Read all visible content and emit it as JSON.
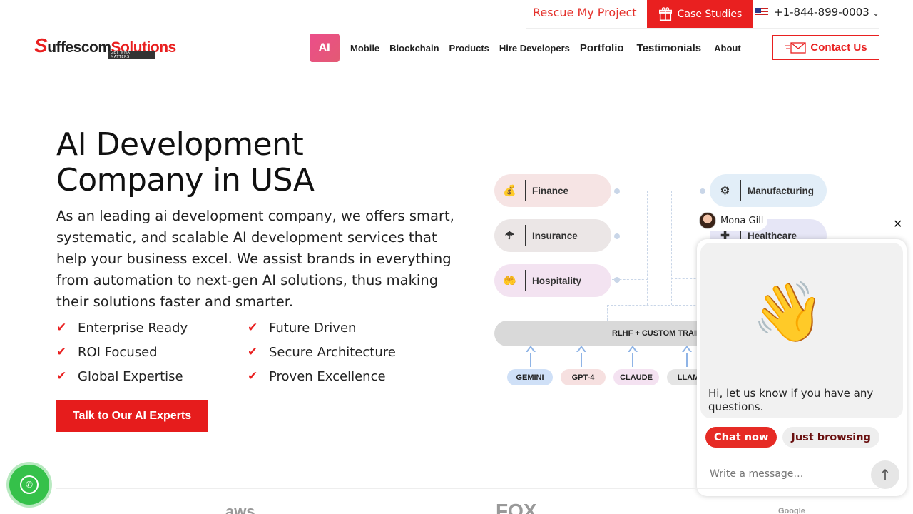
{
  "topbar": {
    "rescue": "Rescue My Project",
    "case_studies": "Case Studies",
    "phone": "+1-844-899-0003"
  },
  "logo": {
    "s": "S",
    "uffescom": "uffescom",
    "solutions": "Solutions",
    "tagline": "GET WHAT MATTERS"
  },
  "nav": {
    "ai": "AI",
    "items": [
      "Mobile",
      "Blockchain",
      "Products",
      "Hire Developers",
      "Portfolio",
      "Testimonials",
      "About"
    ],
    "contact": "Contact Us"
  },
  "hero": {
    "title_line1": "AI Development",
    "title_line2": "Company in USA",
    "description": "As an leading ai development company, we offers smart, systematic, and scalable AI development services that help your business excel. We assist brands in everything from automation to next-gen AI solutions, thus making their solutions faster and smarter.",
    "features": [
      "Enterprise Ready",
      "Future Driven",
      "ROI Focused",
      "Secure Architecture",
      "Global Expertise",
      "Proven Excellence"
    ],
    "cta": "Talk to Our AI Experts"
  },
  "diagram": {
    "left": [
      {
        "label": "Finance",
        "icon": "finance-icon",
        "color": "#f6e4e4"
      },
      {
        "label": "Insurance",
        "icon": "insurance-icon",
        "color": "#ebe6e6"
      },
      {
        "label": "Hospitality",
        "icon": "hospitality-icon",
        "color": "#f3e3f1"
      }
    ],
    "right": [
      {
        "label": "Manufacturing",
        "icon": "manufacturing-icon",
        "color": "#e2eef8"
      },
      {
        "label": "Healthcare",
        "icon": "healthcare-icon",
        "color": "#e6e6f6"
      }
    ],
    "rlhf": "RLHF + CUSTOM TRAIN",
    "models": [
      {
        "label": "GEMINI",
        "color": "#cfe0f7"
      },
      {
        "label": "GPT-4",
        "color": "#f6e0e0"
      },
      {
        "label": "CLAUDE",
        "color": "#f4e2f1"
      },
      {
        "label": "LLAM",
        "color": "#e5e5e5"
      }
    ]
  },
  "chat": {
    "agent": "Mona Gill",
    "close": "✕",
    "greeting": "Hi, let us know if you have any questions.",
    "chat_now": "Chat now",
    "just_browsing": "Just browsing",
    "placeholder": "Write a message…"
  },
  "partners": [
    "aws",
    "FOX",
    "Google"
  ],
  "colors": {
    "accent": "#e92020",
    "whatsapp": "#35c14a"
  }
}
